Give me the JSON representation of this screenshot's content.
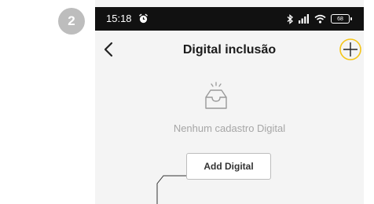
{
  "step": {
    "number": "2"
  },
  "status_bar": {
    "time": "15:18",
    "battery": "68"
  },
  "header": {
    "title": "Digital inclusão",
    "accent_color": "#f5c518"
  },
  "empty_state": {
    "message": "Nenhum cadastro Digital",
    "button_label": "Add Digital"
  },
  "icons": {
    "status": [
      "alarm-icon",
      "bluetooth-icon",
      "signal-icon",
      "wifi-icon",
      "battery-icon"
    ],
    "nav": [
      "back-icon",
      "add-icon"
    ],
    "empty": "empty-tray-icon"
  }
}
